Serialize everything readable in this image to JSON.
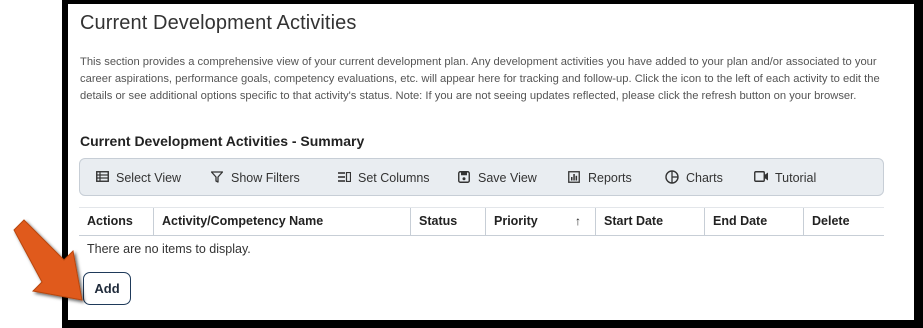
{
  "page": {
    "title": "Current Development Activities",
    "description": "This section provides a comprehensive view of your current development plan. Any development activities you have added to your plan and/or associated to your career aspirations, performance goals, competency evaluations, etc. will appear here for tracking and follow-up. Click the icon to the left of each activity to edit the details or see additional options specific to that activity's status. Note: If you are not seeing updates reflected, please click the refresh button on your browser.",
    "summary_title": "Current Development Activities - Summary"
  },
  "toolbar": {
    "select_view": "Select View",
    "show_filters": "Show Filters",
    "set_columns": "Set Columns",
    "save_view": "Save View",
    "reports": "Reports",
    "charts": "Charts",
    "tutorial": "Tutorial"
  },
  "icons": {
    "select_view": "list-view-icon",
    "show_filters": "filter-icon",
    "set_columns": "columns-icon",
    "save_view": "save-icon",
    "reports": "report-icon",
    "charts": "pie-chart-icon",
    "tutorial": "video-icon",
    "sort": "sort-ascending-icon",
    "annotation": "orange-arrow"
  },
  "table": {
    "columns": [
      "Actions",
      "Activity/Competency Name",
      "Status",
      "Priority",
      "Start Date",
      "End Date",
      "Delete"
    ],
    "sort_indicator": "↑",
    "empty_message": "There are no items to display."
  },
  "actions": {
    "add_label": "Add"
  },
  "colors": {
    "frame": "#000000",
    "toolbar_bg": "#e9edf1",
    "add_border": "#1f3a5a",
    "annotation_arrow": "#e05a1c"
  }
}
